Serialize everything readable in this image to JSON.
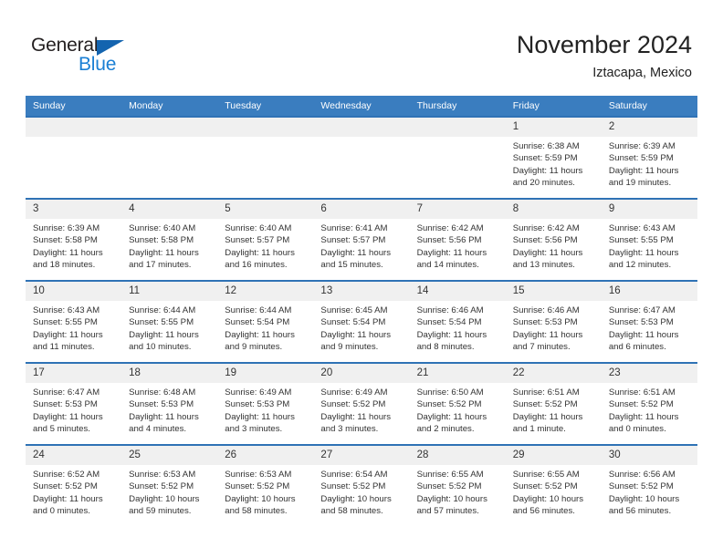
{
  "brand": {
    "name_part1": "General",
    "name_part2": "Blue",
    "triangle_icon": "triangle-icon",
    "colors": {
      "dark": "#231f20",
      "blue": "#1a7fd4",
      "triangle": "#1464af"
    }
  },
  "header": {
    "title": "November 2024",
    "subtitle": "Iztacapa, Mexico"
  },
  "calendar": {
    "header_bg": "#3a7dbf",
    "row_border": "#2f72b5",
    "daynum_bg": "#f0f0f0",
    "weekdays": [
      "Sunday",
      "Monday",
      "Tuesday",
      "Wednesday",
      "Thursday",
      "Friday",
      "Saturday"
    ],
    "weeks": [
      [
        {
          "day": "",
          "sunrise": "",
          "sunset": "",
          "daylight": ""
        },
        {
          "day": "",
          "sunrise": "",
          "sunset": "",
          "daylight": ""
        },
        {
          "day": "",
          "sunrise": "",
          "sunset": "",
          "daylight": ""
        },
        {
          "day": "",
          "sunrise": "",
          "sunset": "",
          "daylight": ""
        },
        {
          "day": "",
          "sunrise": "",
          "sunset": "",
          "daylight": ""
        },
        {
          "day": "1",
          "sunrise": "Sunrise: 6:38 AM",
          "sunset": "Sunset: 5:59 PM",
          "daylight": "Daylight: 11 hours and 20 minutes."
        },
        {
          "day": "2",
          "sunrise": "Sunrise: 6:39 AM",
          "sunset": "Sunset: 5:59 PM",
          "daylight": "Daylight: 11 hours and 19 minutes."
        }
      ],
      [
        {
          "day": "3",
          "sunrise": "Sunrise: 6:39 AM",
          "sunset": "Sunset: 5:58 PM",
          "daylight": "Daylight: 11 hours and 18 minutes."
        },
        {
          "day": "4",
          "sunrise": "Sunrise: 6:40 AM",
          "sunset": "Sunset: 5:58 PM",
          "daylight": "Daylight: 11 hours and 17 minutes."
        },
        {
          "day": "5",
          "sunrise": "Sunrise: 6:40 AM",
          "sunset": "Sunset: 5:57 PM",
          "daylight": "Daylight: 11 hours and 16 minutes."
        },
        {
          "day": "6",
          "sunrise": "Sunrise: 6:41 AM",
          "sunset": "Sunset: 5:57 PM",
          "daylight": "Daylight: 11 hours and 15 minutes."
        },
        {
          "day": "7",
          "sunrise": "Sunrise: 6:42 AM",
          "sunset": "Sunset: 5:56 PM",
          "daylight": "Daylight: 11 hours and 14 minutes."
        },
        {
          "day": "8",
          "sunrise": "Sunrise: 6:42 AM",
          "sunset": "Sunset: 5:56 PM",
          "daylight": "Daylight: 11 hours and 13 minutes."
        },
        {
          "day": "9",
          "sunrise": "Sunrise: 6:43 AM",
          "sunset": "Sunset: 5:55 PM",
          "daylight": "Daylight: 11 hours and 12 minutes."
        }
      ],
      [
        {
          "day": "10",
          "sunrise": "Sunrise: 6:43 AM",
          "sunset": "Sunset: 5:55 PM",
          "daylight": "Daylight: 11 hours and 11 minutes."
        },
        {
          "day": "11",
          "sunrise": "Sunrise: 6:44 AM",
          "sunset": "Sunset: 5:55 PM",
          "daylight": "Daylight: 11 hours and 10 minutes."
        },
        {
          "day": "12",
          "sunrise": "Sunrise: 6:44 AM",
          "sunset": "Sunset: 5:54 PM",
          "daylight": "Daylight: 11 hours and 9 minutes."
        },
        {
          "day": "13",
          "sunrise": "Sunrise: 6:45 AM",
          "sunset": "Sunset: 5:54 PM",
          "daylight": "Daylight: 11 hours and 9 minutes."
        },
        {
          "day": "14",
          "sunrise": "Sunrise: 6:46 AM",
          "sunset": "Sunset: 5:54 PM",
          "daylight": "Daylight: 11 hours and 8 minutes."
        },
        {
          "day": "15",
          "sunrise": "Sunrise: 6:46 AM",
          "sunset": "Sunset: 5:53 PM",
          "daylight": "Daylight: 11 hours and 7 minutes."
        },
        {
          "day": "16",
          "sunrise": "Sunrise: 6:47 AM",
          "sunset": "Sunset: 5:53 PM",
          "daylight": "Daylight: 11 hours and 6 minutes."
        }
      ],
      [
        {
          "day": "17",
          "sunrise": "Sunrise: 6:47 AM",
          "sunset": "Sunset: 5:53 PM",
          "daylight": "Daylight: 11 hours and 5 minutes."
        },
        {
          "day": "18",
          "sunrise": "Sunrise: 6:48 AM",
          "sunset": "Sunset: 5:53 PM",
          "daylight": "Daylight: 11 hours and 4 minutes."
        },
        {
          "day": "19",
          "sunrise": "Sunrise: 6:49 AM",
          "sunset": "Sunset: 5:53 PM",
          "daylight": "Daylight: 11 hours and 3 minutes."
        },
        {
          "day": "20",
          "sunrise": "Sunrise: 6:49 AM",
          "sunset": "Sunset: 5:52 PM",
          "daylight": "Daylight: 11 hours and 3 minutes."
        },
        {
          "day": "21",
          "sunrise": "Sunrise: 6:50 AM",
          "sunset": "Sunset: 5:52 PM",
          "daylight": "Daylight: 11 hours and 2 minutes."
        },
        {
          "day": "22",
          "sunrise": "Sunrise: 6:51 AM",
          "sunset": "Sunset: 5:52 PM",
          "daylight": "Daylight: 11 hours and 1 minute."
        },
        {
          "day": "23",
          "sunrise": "Sunrise: 6:51 AM",
          "sunset": "Sunset: 5:52 PM",
          "daylight": "Daylight: 11 hours and 0 minutes."
        }
      ],
      [
        {
          "day": "24",
          "sunrise": "Sunrise: 6:52 AM",
          "sunset": "Sunset: 5:52 PM",
          "daylight": "Daylight: 11 hours and 0 minutes."
        },
        {
          "day": "25",
          "sunrise": "Sunrise: 6:53 AM",
          "sunset": "Sunset: 5:52 PM",
          "daylight": "Daylight: 10 hours and 59 minutes."
        },
        {
          "day": "26",
          "sunrise": "Sunrise: 6:53 AM",
          "sunset": "Sunset: 5:52 PM",
          "daylight": "Daylight: 10 hours and 58 minutes."
        },
        {
          "day": "27",
          "sunrise": "Sunrise: 6:54 AM",
          "sunset": "Sunset: 5:52 PM",
          "daylight": "Daylight: 10 hours and 58 minutes."
        },
        {
          "day": "28",
          "sunrise": "Sunrise: 6:55 AM",
          "sunset": "Sunset: 5:52 PM",
          "daylight": "Daylight: 10 hours and 57 minutes."
        },
        {
          "day": "29",
          "sunrise": "Sunrise: 6:55 AM",
          "sunset": "Sunset: 5:52 PM",
          "daylight": "Daylight: 10 hours and 56 minutes."
        },
        {
          "day": "30",
          "sunrise": "Sunrise: 6:56 AM",
          "sunset": "Sunset: 5:52 PM",
          "daylight": "Daylight: 10 hours and 56 minutes."
        }
      ]
    ]
  }
}
